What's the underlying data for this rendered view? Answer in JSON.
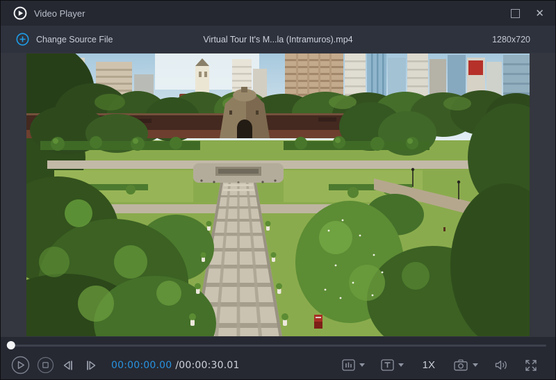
{
  "window": {
    "title": "Video Player"
  },
  "icons": {
    "close_glyph": "✕"
  },
  "toolbar": {
    "change_source_label": "Change Source File",
    "filename": "Virtual Tour It's M...la (Intramuros).mp4",
    "resolution": "1280x720"
  },
  "player": {
    "progress_percent": 0
  },
  "transport": {
    "current_time": "00:00:00.00",
    "time_separator": "/",
    "duration": "00:00:30.01",
    "playback_speed": "1X"
  },
  "colors": {
    "accent_blue": "#1e9de8",
    "time_blue": "#2892e0"
  }
}
